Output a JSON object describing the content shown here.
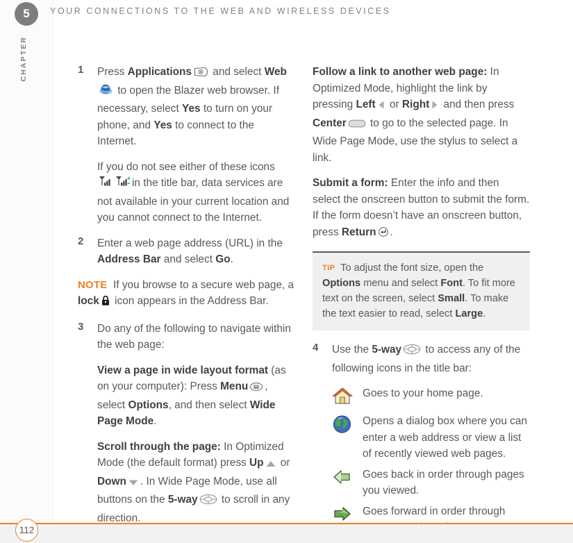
{
  "chapter": {
    "number": "5",
    "label": "CHAPTER"
  },
  "header": {
    "title": "YOUR CONNECTIONS TO THE WEB AND WIRELESS DEVICES"
  },
  "footer": {
    "page_number": "112"
  },
  "colors": {
    "accent_orange": "#ef7f22",
    "body_text": "#58595b",
    "bold_text": "#414042",
    "tip_background": "#f0f0f0",
    "chapter_badge": "#7d7e80"
  },
  "left_column": {
    "step1": {
      "number": "1",
      "part1": "Press ",
      "bold1": "Applications",
      "icon1": "applications-key-icon",
      "part2": " and select ",
      "bold2": "Web",
      "icon2": "blazer-browser-icon",
      "part3": " to open the Blazer web browser. If necessary, select ",
      "bold3": "Yes",
      "part4": " to turn on your phone, and ",
      "bold4": "Yes",
      "part5": " to connect to the Internet.",
      "note_para1": "If you do not see either of these icons",
      "icon3": "signal-bars-icon",
      "icon4": "signal-bars-data-icon",
      "note_para2": "in the title bar, data services are not available in your current location and you cannot connect to the Internet."
    },
    "step2": {
      "number": "2",
      "part1": "Enter a web page address (URL) in the ",
      "bold1": "Address Bar",
      "part2": " and select ",
      "bold2": "Go",
      "part3": "."
    },
    "note": {
      "label": "NOTE",
      "part1": "If you browse to a secure web page, a ",
      "bold1": "lock",
      "icon": "lock-icon",
      "part2": " icon appears in the Address Bar."
    },
    "step3": {
      "number": "3",
      "intro": "Do any of the following to navigate within the web page:",
      "wide_bold": "View a page in wide layout format",
      "wide_part1": " (as on your computer): Press ",
      "wide_bold2": "Menu",
      "wide_icon": "menu-key-icon",
      "wide_part2": ", select ",
      "wide_bold3": "Options",
      "wide_part3": ", and then select ",
      "wide_bold4": "Wide Page Mode",
      "wide_part4": ".",
      "scroll_bold": "Scroll through the page:",
      "scroll_part1": " In Optimized Mode (the default format) press ",
      "scroll_bold2": "Up",
      "scroll_icon_up": "triangle-up-icon",
      "scroll_part2": " or ",
      "scroll_bold3": "Down",
      "scroll_icon_down": "triangle-down-icon",
      "scroll_part3": ". In Wide Page Mode, use all buttons on the ",
      "scroll_bold4": "5-way",
      "scroll_icon_5way": "five-way-navigator-icon",
      "scroll_part4": " to scroll in any direction."
    }
  },
  "right_column": {
    "follow_link": {
      "bold1": "Follow a link to another web page:",
      "part1": " In Optimized Mode, highlight the link by pressing ",
      "bold2": "Left",
      "icon_left": "triangle-left-icon",
      "part2": " or ",
      "bold3": "Right",
      "icon_right": "triangle-right-icon",
      "part3": " and then press ",
      "bold4": "Center",
      "icon_center": "center-button-icon",
      "part4": " to go to the selected page. In Wide Page Mode, use the stylus to select a link."
    },
    "submit_form": {
      "bold1": "Submit a form:",
      "part1": " Enter the info and then select the onscreen button to submit the form. If the form doesn’t have an onscreen button, press ",
      "bold2": "Return",
      "icon_return": "return-key-icon",
      "part2": "."
    },
    "tip": {
      "label": "TIP",
      "part1": "To adjust the font size, open the ",
      "bold1": "Options",
      "part2": " menu and select ",
      "bold2": "Font",
      "part3": ". To fit more text on the screen, select ",
      "bold3": "Small",
      "part4": ". To make the text easier to read, select ",
      "bold4": "Large",
      "part5": "."
    },
    "step4": {
      "number": "4",
      "part1": "Use the ",
      "bold1": "5-way",
      "icon": "five-way-navigator-icon",
      "part2": " to access any of the following icons in the title bar:",
      "icon_rows": [
        {
          "icon": "home-icon",
          "text": "Goes to your home page."
        },
        {
          "icon": "globe-icon",
          "text": "Opens a dialog box where you can enter a web address or view a list of recently viewed web pages."
        },
        {
          "icon": "arrow-back-icon",
          "text": "Goes back in order through pages you viewed."
        },
        {
          "icon": "arrow-forward-icon",
          "text": "Goes forward in order through pages you viewed."
        }
      ]
    }
  }
}
